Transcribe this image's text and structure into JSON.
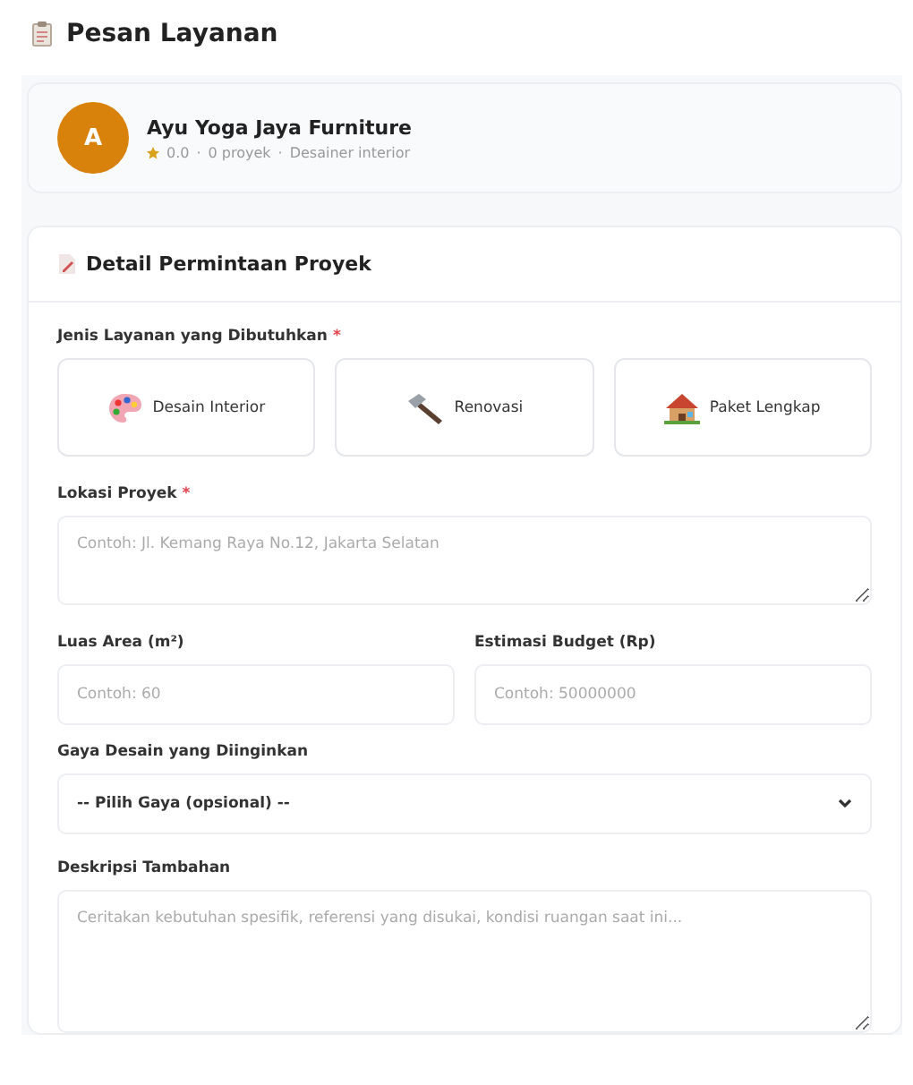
{
  "page_title": "Pesan Layanan",
  "provider": {
    "initial": "A",
    "name": "Ayu Yoga Jaya Furniture",
    "rating": "0.0",
    "projects": "0 proyek",
    "role": "Desainer interior",
    "separator": "·"
  },
  "form": {
    "title": "Detail Permintaan Proyek",
    "required_mark": "*",
    "service": {
      "label": "Jenis Layanan yang Dibutuhkan",
      "required": true,
      "options": [
        {
          "kind": "palette",
          "label": "Desain Interior",
          "selected": false
        },
        {
          "kind": "hammer",
          "label": "Renovasi",
          "selected": false
        },
        {
          "kind": "house",
          "label": "Paket Lengkap",
          "selected": false
        }
      ]
    },
    "location": {
      "label": "Lokasi Proyek",
      "required": true,
      "placeholder": "Contoh: Jl. Kemang Raya No.12, Jakarta Selatan"
    },
    "area": {
      "label": "Luas Area (m²)",
      "placeholder": "Contoh: 60"
    },
    "budget": {
      "label": "Estimasi Budget (Rp)",
      "placeholder": "Contoh: 50000000"
    },
    "style": {
      "label": "Gaya Desain yang Diinginkan",
      "value": "-- Pilih Gaya (opsional) --"
    },
    "description": {
      "label": "Deskripsi Tambahan",
      "placeholder": "Ceritakan kebutuhan spesifik, referensi yang disukai, kondisi ruangan saat ini..."
    }
  }
}
